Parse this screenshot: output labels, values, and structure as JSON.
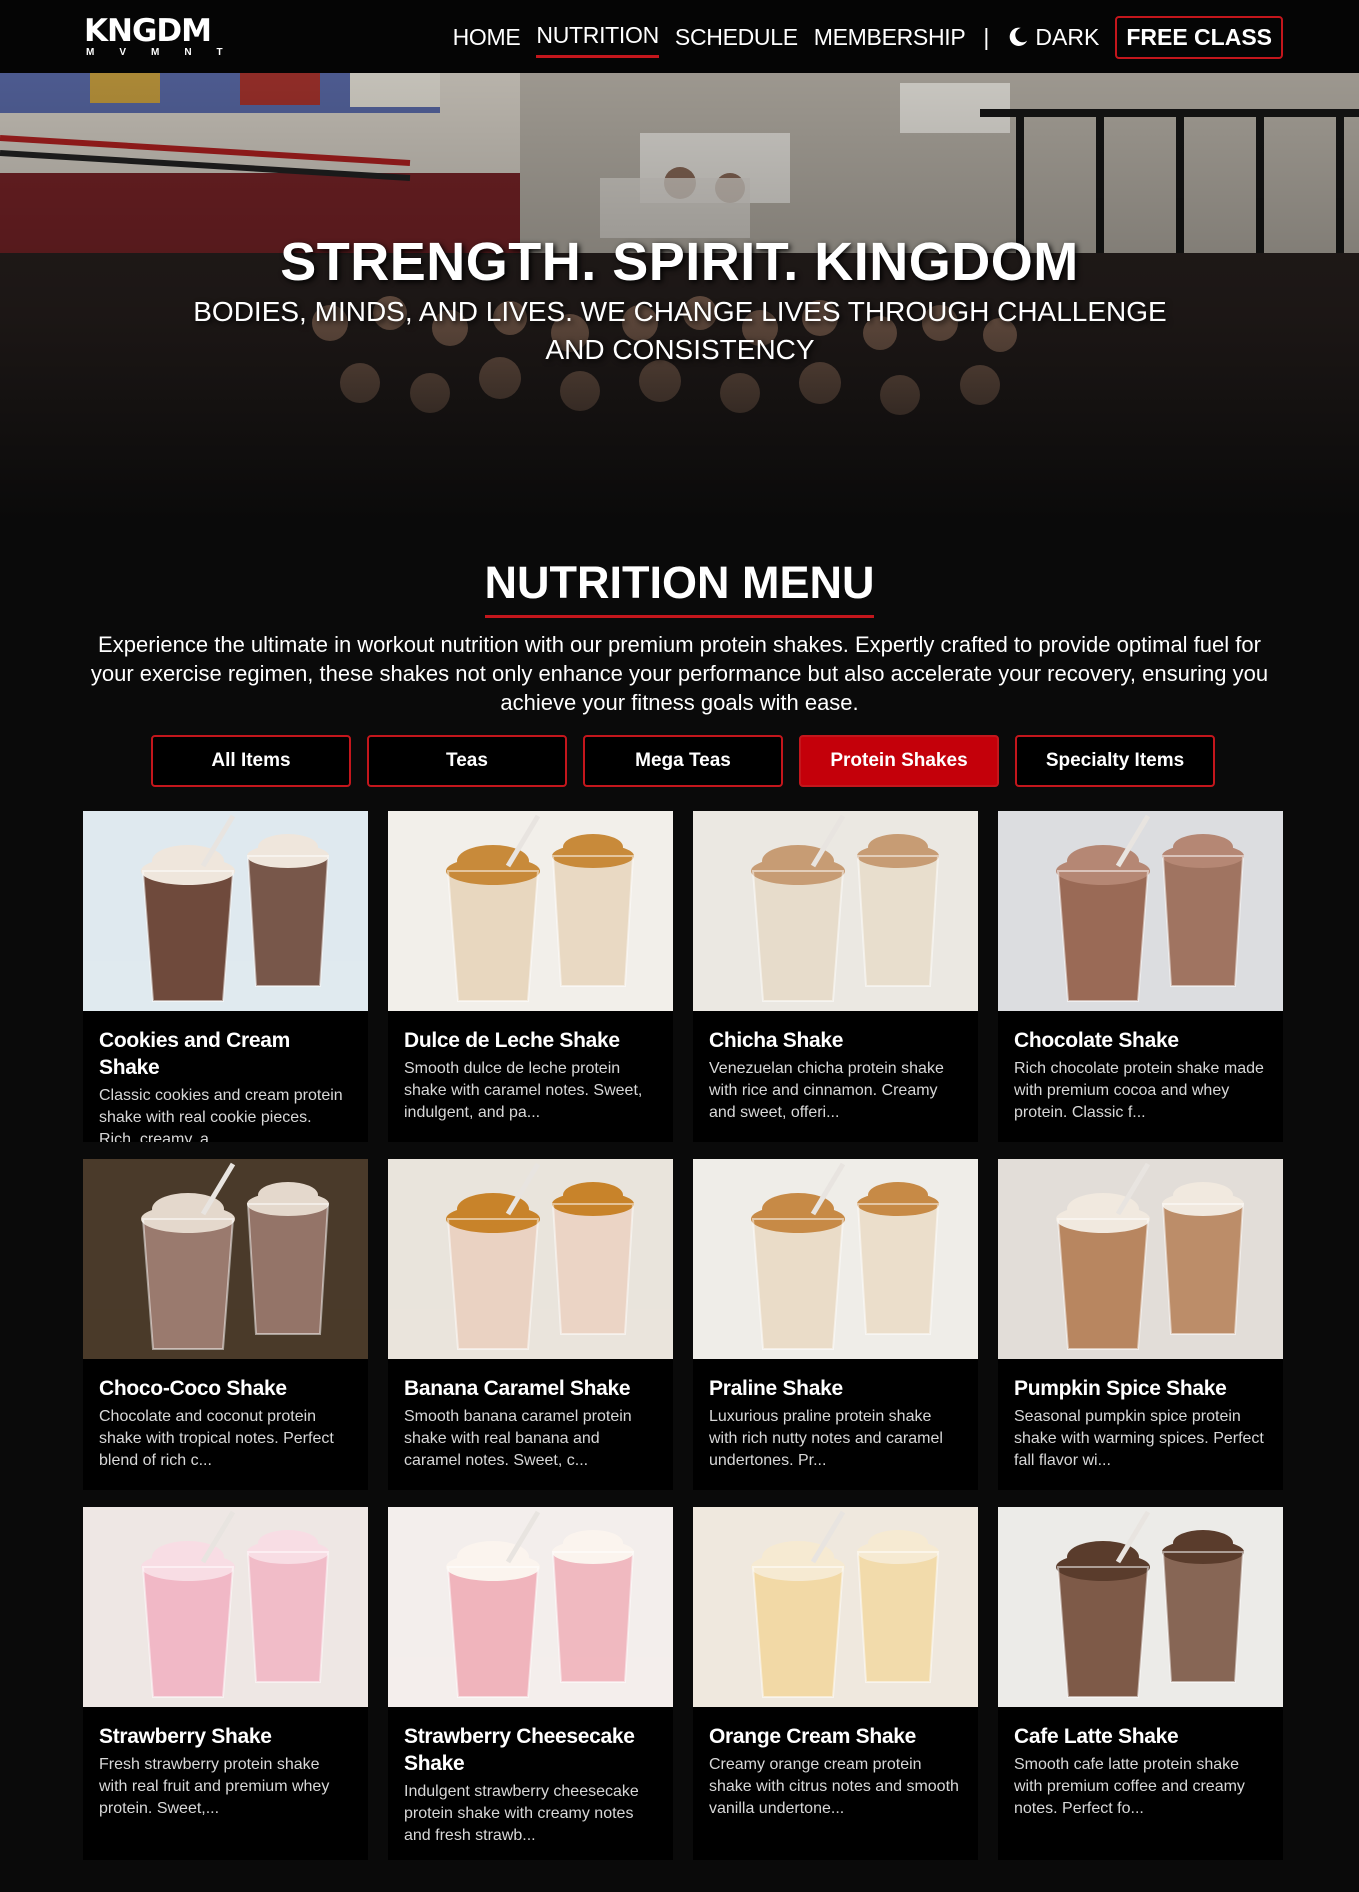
{
  "nav": {
    "logo_main": "KNGDM",
    "logo_sub": "MVMNT",
    "links": [
      "HOME",
      "NUTRITION",
      "SCHEDULE",
      "MEMBERSHIP"
    ],
    "separator": "|",
    "dark_label": "DARK",
    "cta_label": "FREE CLASS"
  },
  "hero": {
    "title": "STRENGTH. SPIRIT. KINGDOM",
    "subtitle": "BODIES, MINDS, AND LIVES. WE CHANGE LIVES THROUGH CHALLENGE AND CONSISTENCY"
  },
  "menu": {
    "title": "NUTRITION MENU",
    "intro": "Experience the ultimate in workout nutrition with our premium protein shakes. Expertly crafted to provide optimal fuel for your exercise regimen, these shakes not only enhance your performance but also accelerate your recovery, ensuring you achieve your fitness goals with ease.",
    "filters": [
      "All Items",
      "Teas",
      "Mega Teas",
      "Protein Shakes",
      "Specialty Items"
    ],
    "active_filter": "Protein Shakes"
  },
  "accent_color": "#c4161c",
  "items": [
    {
      "title": "Cookies and Cream Shake",
      "desc": "Classic cookies and cream protein shake with real cookie pieces. Rich, creamy, a...",
      "bg": "#dfe9ef",
      "drink": "#6f4a3c",
      "top": "#efe6dc"
    },
    {
      "title": "Dulce de Leche Shake",
      "desc": "Smooth dulce de leche protein shake with caramel notes. Sweet, indulgent, and pa...",
      "bg": "#f2efea",
      "drink": "#e8d7bf",
      "top": "#c88a3a"
    },
    {
      "title": "Chicha Shake",
      "desc": "Venezuelan chicha protein shake with rice and cinnamon. Creamy and sweet, offeri...",
      "bg": "#ebe8e2",
      "drink": "#e7dccb",
      "top": "#c79c74"
    },
    {
      "title": "Chocolate Shake",
      "desc": "Rich chocolate protein shake made with premium cocoa and whey protein. Classic f...",
      "bg": "#dcdde0",
      "drink": "#9a6a56",
      "top": "#b58774"
    },
    {
      "title": "Choco-Coco Shake",
      "desc": "Chocolate and coconut protein shake with tropical notes. Perfect blend of rich c...",
      "bg": "#4a3a2a",
      "drink": "#9a7a6e",
      "top": "#e4d8cc"
    },
    {
      "title": "Banana Caramel Shake",
      "desc": "Smooth banana caramel protein shake with real banana and caramel notes. Sweet, c...",
      "bg": "#e9e4dc",
      "drink": "#ead2c2",
      "top": "#c8832a"
    },
    {
      "title": "Praline Shake",
      "desc": "Luxurious praline protein shake with rich nutty notes and caramel undertones. Pr...",
      "bg": "#efede8",
      "drink": "#eadcc8",
      "top": "#c78a46"
    },
    {
      "title": "Pumpkin Spice Shake",
      "desc": "Seasonal pumpkin spice protein shake with warming spices. Perfect fall flavor wi...",
      "bg": "#e2ddd8",
      "drink": "#b88660",
      "top": "#f1e9df"
    },
    {
      "title": "Strawberry Shake",
      "desc": "Fresh strawberry protein shake with real fruit and premium whey protein. Sweet,...",
      "bg": "#eee7e4",
      "drink": "#f1b8c6",
      "top": "#f8dde4"
    },
    {
      "title": "Strawberry Cheesecake Shake",
      "desc": "Indulgent strawberry cheesecake protein shake with creamy notes and fresh strawb...",
      "bg": "#f3eeec",
      "drink": "#f0b4bc",
      "top": "#fbf4ee"
    },
    {
      "title": "Orange Cream Shake",
      "desc": "Creamy orange cream protein shake with citrus notes and smooth vanilla undertone...",
      "bg": "#efe8de",
      "drink": "#f2d9a6",
      "top": "#f6ead2"
    },
    {
      "title": "Cafe Latte Shake",
      "desc": "Smooth cafe latte protein shake with premium coffee and creamy notes. Perfect fo...",
      "bg": "#ecebe8",
      "drink": "#7e5a48",
      "top": "#5a3c2c"
    }
  ]
}
